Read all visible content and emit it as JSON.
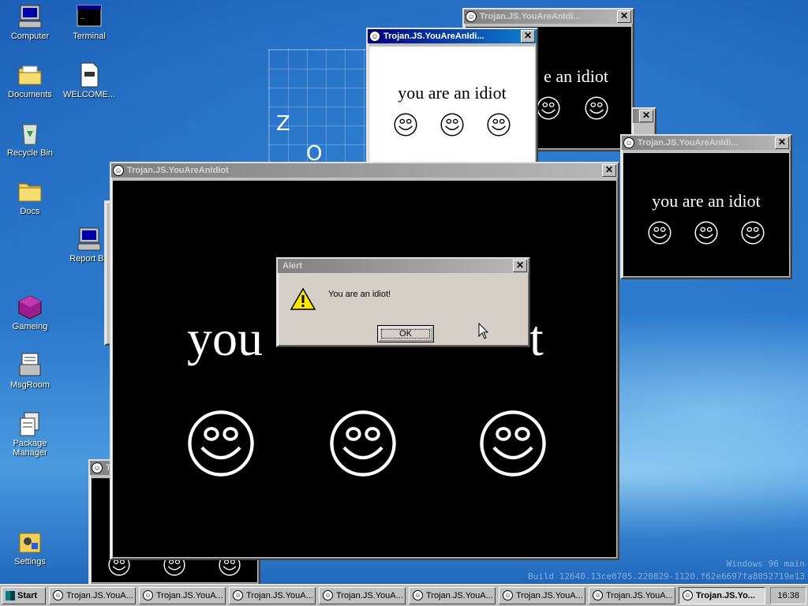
{
  "desktop_icons": [
    {
      "label": "Computer",
      "icon": "computer-icon"
    },
    {
      "label": "Terminal",
      "icon": "terminal-icon"
    },
    {
      "label": "Documents",
      "icon": "folder-icon"
    },
    {
      "label": "WELCOME...",
      "icon": "document-icon"
    },
    {
      "label": "Recycle Bin",
      "icon": "recycle-bin-icon"
    },
    {
      "label": "Docs",
      "icon": "folder-icon"
    },
    {
      "label": "Report Bu",
      "icon": "computer-icon"
    },
    {
      "label": "Gameing",
      "icon": "cube-icon"
    },
    {
      "label": "MsgRoom",
      "icon": "chat-icon"
    },
    {
      "label": "Package Manager",
      "icon": "package-icon"
    },
    {
      "label": "Settings",
      "icon": "settings-icon"
    }
  ],
  "background": {
    "letters": [
      "Z",
      "O"
    ],
    "watermark_line1": "Windows 96 main",
    "watermark_line2": "Build 12640.13ce0705.220829-1120.f62e6697fa8052719e13"
  },
  "popup_title": "Trojan.JS.YouAreAnIdiot",
  "popup_title_short": "Trojan.JS.YouAreAnIdi...",
  "popup_title_short2": "Trojan.JS.YouAreAnIdi...",
  "popup_text": "you are an idiot",
  "popup_text_partial": "e an idiot",
  "main_window": {
    "title": "Trojan.JS.YouAreAnIdiot",
    "text_left": "you",
    "text_right": "t"
  },
  "alert": {
    "title": "Alert",
    "message": "You are an idiot!",
    "ok_label": "OK",
    "icon": "warning-icon"
  },
  "taskbar": {
    "start_label": "Start",
    "buttons": [
      "Trojan.JS.YouA...",
      "Trojan.JS.YouA...",
      "Trojan.JS.YouA...",
      "Trojan.JS.YouA...",
      "Trojan.JS.YouA...",
      "Trojan.JS.YouA...",
      "Trojan.JS.YouA...",
      "Trojan.JS.Yo..."
    ],
    "clock": "16:38"
  },
  "colors": {
    "titlebar_active": "#000080",
    "titlebar_inactive": "#808080",
    "window_face": "#c0c0c0",
    "desktop": "#1d63b8"
  }
}
